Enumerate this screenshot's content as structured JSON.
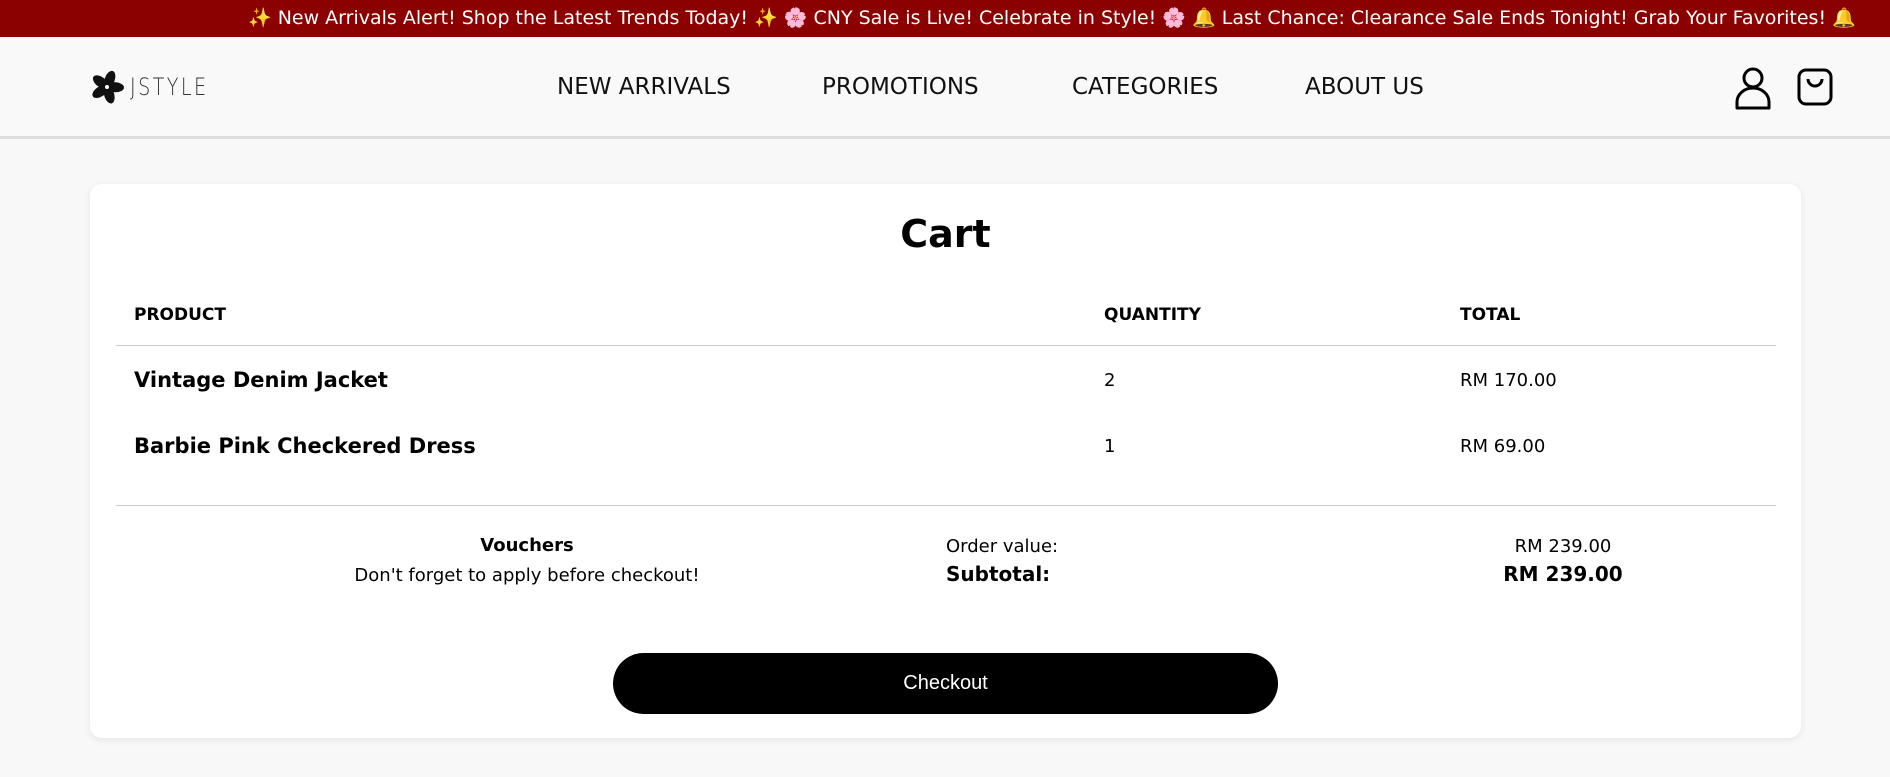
{
  "banner": {
    "text": "✨ New Arrivals Alert! Shop the Latest Trends Today! ✨  🌸 CNY Sale is Live! Celebrate in Style! 🌸  🔔 Last Chance: Clearance Sale Ends Tonight! Grab Your Favorites! 🔔"
  },
  "header": {
    "logo": "JSTYLE",
    "nav": [
      "NEW ARRIVALS",
      "PROMOTIONS",
      "CATEGORIES",
      "ABOUT US"
    ],
    "icons": [
      "user-icon",
      "shopping-bag-icon"
    ]
  },
  "cart": {
    "title": "Cart",
    "columns": [
      "PRODUCT",
      "QUANTITY",
      "TOTAL"
    ],
    "items": [
      {
        "name": "Vintage Denim Jacket",
        "quantity": "2",
        "total": "RM 170.00"
      },
      {
        "name": "Barbie Pink Checkered Dress",
        "quantity": "1",
        "total": "RM 69.00"
      }
    ],
    "vouchers_title": "Vouchers",
    "vouchers_note": "Don't forget to apply before checkout!",
    "order_value_label": "Order value:",
    "subtotal_label": "Subtotal:",
    "order_value": "RM 239.00",
    "subtotal": "RM 239.00",
    "checkout_label": "Checkout"
  },
  "colors": {
    "banner": "#8b0000",
    "button": "#000000"
  }
}
